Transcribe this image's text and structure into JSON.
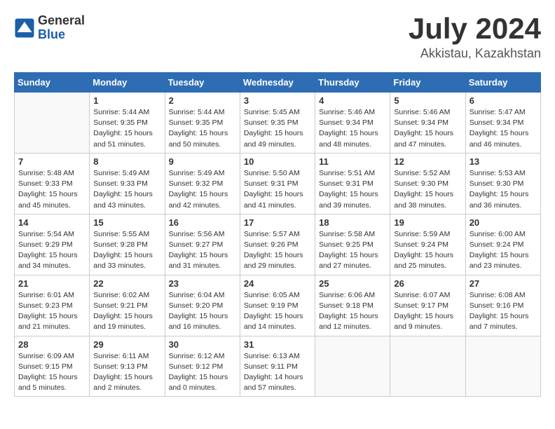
{
  "header": {
    "logo_general": "General",
    "logo_blue": "Blue",
    "month_title": "July 2024",
    "location": "Akkistau, Kazakhstan"
  },
  "weekdays": [
    "Sunday",
    "Monday",
    "Tuesday",
    "Wednesday",
    "Thursday",
    "Friday",
    "Saturday"
  ],
  "weeks": [
    [
      {
        "day": "",
        "info": ""
      },
      {
        "day": "1",
        "info": "Sunrise: 5:44 AM\nSunset: 9:35 PM\nDaylight: 15 hours\nand 51 minutes."
      },
      {
        "day": "2",
        "info": "Sunrise: 5:44 AM\nSunset: 9:35 PM\nDaylight: 15 hours\nand 50 minutes."
      },
      {
        "day": "3",
        "info": "Sunrise: 5:45 AM\nSunset: 9:35 PM\nDaylight: 15 hours\nand 49 minutes."
      },
      {
        "day": "4",
        "info": "Sunrise: 5:46 AM\nSunset: 9:34 PM\nDaylight: 15 hours\nand 48 minutes."
      },
      {
        "day": "5",
        "info": "Sunrise: 5:46 AM\nSunset: 9:34 PM\nDaylight: 15 hours\nand 47 minutes."
      },
      {
        "day": "6",
        "info": "Sunrise: 5:47 AM\nSunset: 9:34 PM\nDaylight: 15 hours\nand 46 minutes."
      }
    ],
    [
      {
        "day": "7",
        "info": "Sunrise: 5:48 AM\nSunset: 9:33 PM\nDaylight: 15 hours\nand 45 minutes."
      },
      {
        "day": "8",
        "info": "Sunrise: 5:49 AM\nSunset: 9:33 PM\nDaylight: 15 hours\nand 43 minutes."
      },
      {
        "day": "9",
        "info": "Sunrise: 5:49 AM\nSunset: 9:32 PM\nDaylight: 15 hours\nand 42 minutes."
      },
      {
        "day": "10",
        "info": "Sunrise: 5:50 AM\nSunset: 9:31 PM\nDaylight: 15 hours\nand 41 minutes."
      },
      {
        "day": "11",
        "info": "Sunrise: 5:51 AM\nSunset: 9:31 PM\nDaylight: 15 hours\nand 39 minutes."
      },
      {
        "day": "12",
        "info": "Sunrise: 5:52 AM\nSunset: 9:30 PM\nDaylight: 15 hours\nand 38 minutes."
      },
      {
        "day": "13",
        "info": "Sunrise: 5:53 AM\nSunset: 9:30 PM\nDaylight: 15 hours\nand 36 minutes."
      }
    ],
    [
      {
        "day": "14",
        "info": "Sunrise: 5:54 AM\nSunset: 9:29 PM\nDaylight: 15 hours\nand 34 minutes."
      },
      {
        "day": "15",
        "info": "Sunrise: 5:55 AM\nSunset: 9:28 PM\nDaylight: 15 hours\nand 33 minutes."
      },
      {
        "day": "16",
        "info": "Sunrise: 5:56 AM\nSunset: 9:27 PM\nDaylight: 15 hours\nand 31 minutes."
      },
      {
        "day": "17",
        "info": "Sunrise: 5:57 AM\nSunset: 9:26 PM\nDaylight: 15 hours\nand 29 minutes."
      },
      {
        "day": "18",
        "info": "Sunrise: 5:58 AM\nSunset: 9:25 PM\nDaylight: 15 hours\nand 27 minutes."
      },
      {
        "day": "19",
        "info": "Sunrise: 5:59 AM\nSunset: 9:24 PM\nDaylight: 15 hours\nand 25 minutes."
      },
      {
        "day": "20",
        "info": "Sunrise: 6:00 AM\nSunset: 9:24 PM\nDaylight: 15 hours\nand 23 minutes."
      }
    ],
    [
      {
        "day": "21",
        "info": "Sunrise: 6:01 AM\nSunset: 9:23 PM\nDaylight: 15 hours\nand 21 minutes."
      },
      {
        "day": "22",
        "info": "Sunrise: 6:02 AM\nSunset: 9:21 PM\nDaylight: 15 hours\nand 19 minutes."
      },
      {
        "day": "23",
        "info": "Sunrise: 6:04 AM\nSunset: 9:20 PM\nDaylight: 15 hours\nand 16 minutes."
      },
      {
        "day": "24",
        "info": "Sunrise: 6:05 AM\nSunset: 9:19 PM\nDaylight: 15 hours\nand 14 minutes."
      },
      {
        "day": "25",
        "info": "Sunrise: 6:06 AM\nSunset: 9:18 PM\nDaylight: 15 hours\nand 12 minutes."
      },
      {
        "day": "26",
        "info": "Sunrise: 6:07 AM\nSunset: 9:17 PM\nDaylight: 15 hours\nand 9 minutes."
      },
      {
        "day": "27",
        "info": "Sunrise: 6:08 AM\nSunset: 9:16 PM\nDaylight: 15 hours\nand 7 minutes."
      }
    ],
    [
      {
        "day": "28",
        "info": "Sunrise: 6:09 AM\nSunset: 9:15 PM\nDaylight: 15 hours\nand 5 minutes."
      },
      {
        "day": "29",
        "info": "Sunrise: 6:11 AM\nSunset: 9:13 PM\nDaylight: 15 hours\nand 2 minutes."
      },
      {
        "day": "30",
        "info": "Sunrise: 6:12 AM\nSunset: 9:12 PM\nDaylight: 15 hours\nand 0 minutes."
      },
      {
        "day": "31",
        "info": "Sunrise: 6:13 AM\nSunset: 9:11 PM\nDaylight: 14 hours\nand 57 minutes."
      },
      {
        "day": "",
        "info": ""
      },
      {
        "day": "",
        "info": ""
      },
      {
        "day": "",
        "info": ""
      }
    ]
  ]
}
